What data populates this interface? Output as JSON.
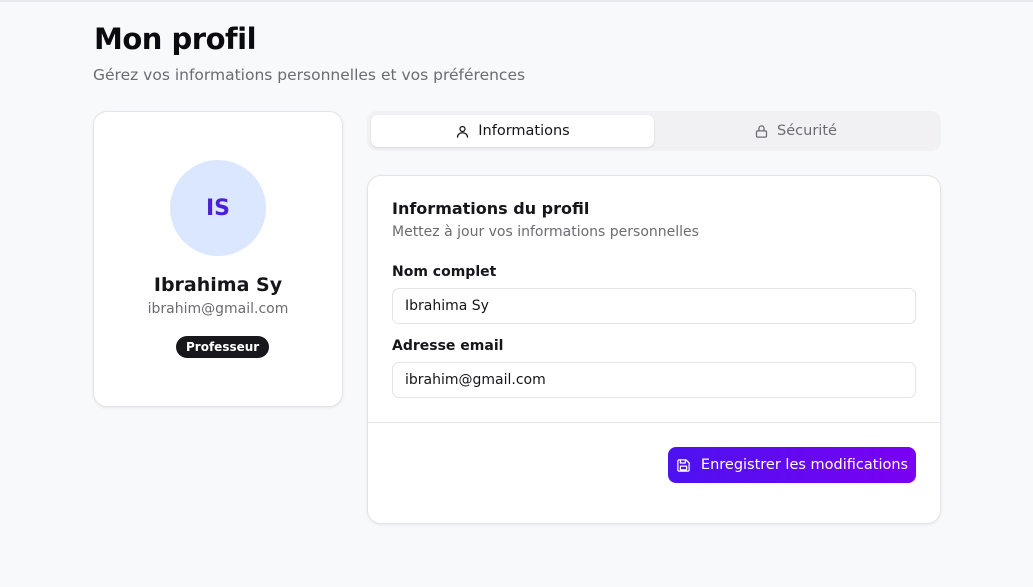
{
  "header": {
    "title": "Mon profil",
    "subtitle": "Gérez vos informations personnelles et vos préférences"
  },
  "profile": {
    "initials": "IS",
    "name": "Ibrahima Sy",
    "email": "ibrahim@gmail.com",
    "role": "Professeur",
    "avatar_bg": "#dbe7fe",
    "avatar_text_color": "#4b1fd6"
  },
  "tabs": [
    {
      "label": "Informations",
      "icon": "user-icon",
      "active": true
    },
    {
      "label": "Sécurité",
      "icon": "lock-icon",
      "active": false
    }
  ],
  "form": {
    "title": "Informations du profil",
    "description": "Mettez à jour vos informations personnelles",
    "fields": [
      {
        "label": "Nom complet",
        "value": "Ibrahima Sy"
      },
      {
        "label": "Adresse email",
        "value": "ibrahim@gmail.com"
      }
    ],
    "save_label": "Enregistrer les modifications",
    "save_icon": "save-icon",
    "accent": "#5b0bf2"
  }
}
